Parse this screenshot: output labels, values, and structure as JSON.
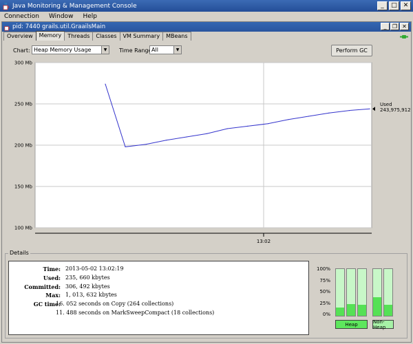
{
  "window": {
    "title": "Java Monitoring & Management Console",
    "controls": {
      "minimize": "_",
      "maximize": "□",
      "close": "✕"
    }
  },
  "menubar": [
    {
      "label": "Connection"
    },
    {
      "label": "Window"
    },
    {
      "label": "Help"
    }
  ],
  "internal_frame": {
    "title": "pid: 7440 grails.util.GraailsMain",
    "controls": {
      "minimize": "_",
      "restore": "❐",
      "close": "✕"
    }
  },
  "tabs": [
    {
      "label": "Overview",
      "active": false
    },
    {
      "label": "Memory",
      "active": true
    },
    {
      "label": "Threads",
      "active": false
    },
    {
      "label": "Classes",
      "active": false
    },
    {
      "label": "VM Summary",
      "active": false
    },
    {
      "label": "MBeans",
      "active": false
    }
  ],
  "controls": {
    "chart_label": "Chart:",
    "chart_value": "Heap Memory Usage",
    "range_label": "Time Range:",
    "range_value": "All",
    "gc_button": "Perform GC"
  },
  "chart_data": {
    "type": "line",
    "ylim": [
      100,
      300
    ],
    "y_ticks": [
      "100 Mb",
      "150 Mb",
      "200 Mb",
      "250 Mb",
      "300 Mb"
    ],
    "x_ticks": [
      "13:02"
    ],
    "series": [
      {
        "name": "Used",
        "x": [
          0,
          1,
          2,
          3,
          4,
          5,
          6,
          7,
          8,
          9,
          10,
          11,
          12,
          13
        ],
        "values": [
          274,
          198,
          201,
          206,
          210,
          214,
          220,
          223,
          226,
          231,
          235,
          239,
          242,
          244
        ]
      }
    ],
    "annotation": {
      "label": "Used",
      "value": "243,975,912"
    }
  },
  "details": {
    "title": "Details",
    "rows": [
      {
        "label": "Time:",
        "value": "2013-05-02 13:02:19"
      },
      {
        "label": "Used:",
        "value": "235, 660 kbytes"
      },
      {
        "label": "Committed:",
        "value": "306, 492 kbytes"
      },
      {
        "label": "Max:",
        "value": "1, 013, 632 kbytes"
      },
      {
        "label": "GC time:",
        "value": "16. 052  seconds on Copy (264 collections)"
      },
      {
        "label": "",
        "value": "11. 488  seconds on MarkSweepCompact (18 collections)"
      }
    ],
    "pct_labels": [
      "100%",
      "75%",
      "50%",
      "25%",
      "0%"
    ],
    "heap_bars": [
      0.18,
      0.25,
      0.23
    ],
    "nonheap_bars": [
      0.4,
      0.23
    ],
    "heap_button": "Heap",
    "nonheap_button": "Non-Heap"
  }
}
